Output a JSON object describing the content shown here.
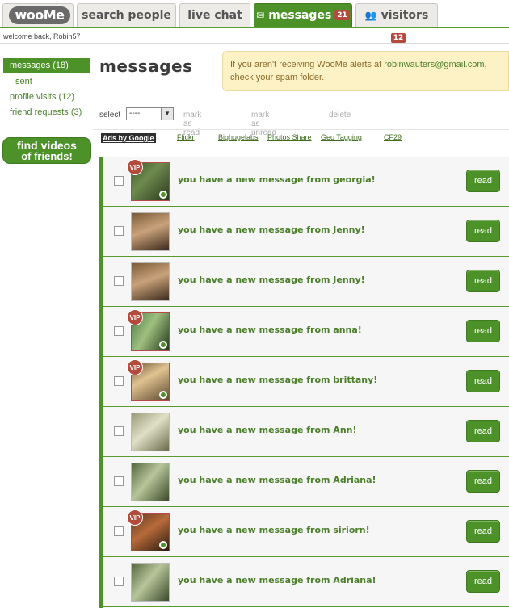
{
  "nav": {
    "logo": "wooMe",
    "tabs": [
      {
        "label": "search people"
      },
      {
        "label": "live chat"
      },
      {
        "label": "messages",
        "count": "21"
      },
      {
        "label": "visitors",
        "count": "12"
      }
    ]
  },
  "welcome": "welcome back, Robin57",
  "sidebar": {
    "items": [
      {
        "label": "messages (18)"
      },
      {
        "label": "sent"
      },
      {
        "label": "profile visits (12)"
      },
      {
        "label": "friend requests (3)"
      }
    ],
    "find_videos_line1": "find videos",
    "find_videos_line2": "of friends!"
  },
  "main": {
    "title": "messages",
    "alert": {
      "prefix": "If you aren't receiving WooMe alerts at ",
      "email": "robinwauters@gmail.com",
      "suffix": "check your spam folder."
    },
    "actions": {
      "select_label": "select",
      "select_value": "----",
      "mark_read": "mark as read",
      "mark_unread": "mark as unread",
      "delete": "delete"
    },
    "ads": {
      "label": "Ads by Google",
      "links": [
        "Flickr",
        "Bighugelabs",
        "Photos Share",
        "Geo Tagging",
        "CF29"
      ]
    },
    "messages": [
      {
        "text": "you have a new message from georgia!",
        "vip": "VIP",
        "button": "read"
      },
      {
        "text": "you have a new message from Jenny!",
        "button": "read"
      },
      {
        "text": "you have a new message from Jenny!",
        "button": "read"
      },
      {
        "text": "you have a new message from anna!",
        "vip": "VIP",
        "button": "read"
      },
      {
        "text": "you have a new message from brittany!",
        "vip": "VIP",
        "button": "read"
      },
      {
        "text": "you have a new message from Ann!",
        "button": "read"
      },
      {
        "text": "you have a new message from Adriana!",
        "button": "read"
      },
      {
        "text": "you have a new message from siriorn!",
        "vip": "VIP",
        "button": "read"
      },
      {
        "text": "you have a new message from Adriana!",
        "button": "read"
      }
    ]
  },
  "colors": {
    "brand_green": "#4c9228",
    "badge_red": "#b34b3c",
    "alert_bg": "#fcf2c6"
  }
}
